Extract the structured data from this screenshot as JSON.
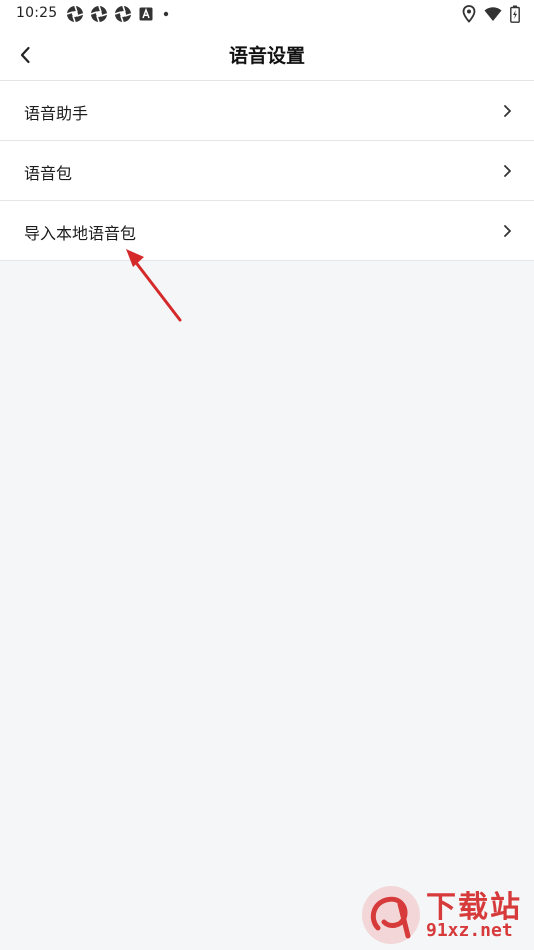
{
  "status_bar": {
    "time": "10:25",
    "left_icons": [
      "aperture-icon",
      "aperture-icon",
      "aperture-icon",
      "a-box-icon",
      "dot-icon"
    ],
    "right_icons": [
      "location-icon",
      "wifi-icon",
      "battery-icon"
    ]
  },
  "header": {
    "title": "语音设置",
    "back_icon": "chevron-left-icon"
  },
  "menu": {
    "items": [
      {
        "label": "语音助手"
      },
      {
        "label": "语音包"
      },
      {
        "label": "导入本地语音包"
      }
    ]
  },
  "annotation": {
    "arrow_color": "#d42a2a",
    "target": "导入本地语音包"
  },
  "watermark": {
    "brand_cn": "下载站",
    "url": "91xz.net",
    "color": "#d63a3a"
  },
  "colors": {
    "background": "#f5f6f8",
    "surface": "#ffffff",
    "divider": "#e6e6e8",
    "text_primary": "#1c1c1c"
  }
}
